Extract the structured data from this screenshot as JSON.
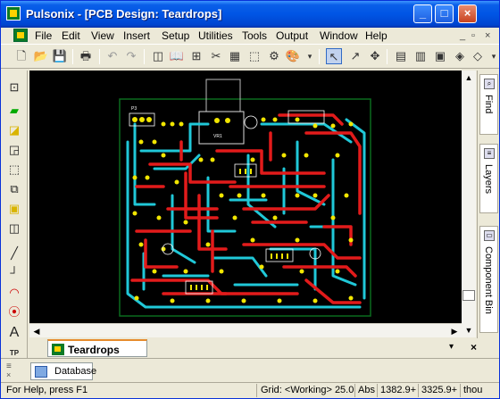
{
  "window": {
    "title": "Pulsonix - [PCB Design: Teardrops]"
  },
  "menu": [
    "File",
    "Edit",
    "View",
    "Insert",
    "Setup",
    "Utilities",
    "Tools",
    "Output",
    "Window",
    "Help"
  ],
  "doc_tab": {
    "label": "Teardrops"
  },
  "output_tab": {
    "label": "Database"
  },
  "right_tabs": [
    "Find",
    "Layers",
    "Component Bin"
  ],
  "status": {
    "help": "For Help, press F1",
    "grid": "Grid: <Working> 25.0",
    "mode": "Abs",
    "x": "1382.9+",
    "y": "3325.9+",
    "units": "thou"
  },
  "colors": {
    "pcb_background": "#000000",
    "board_outline": "#0a6b1e",
    "copper_top": "#e21b1b",
    "copper_bottom": "#20c8d8",
    "pads": "#f2e600",
    "silkscreen": "#ffffff"
  }
}
